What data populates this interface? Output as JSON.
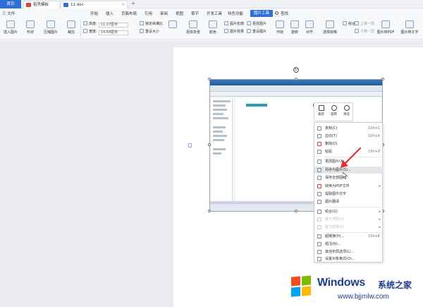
{
  "tabbar": {
    "home": "首页",
    "tabs": [
      {
        "label": "稻壳模板",
        "icon": "docer-icon",
        "color": "#d9433a"
      },
      {
        "label": "12.doc",
        "icon": "word-doc-icon",
        "color": "#2f6fd6"
      }
    ],
    "new_tab": "+"
  },
  "menubar": {
    "file": "三 文件",
    "items": [
      "开始",
      "插入",
      "页面布局",
      "引用",
      "审阅",
      "视图",
      "章节",
      "开发工具",
      "特色功能"
    ],
    "active": "图片工具",
    "search": "查找"
  },
  "ribbon": {
    "insert_picture": "插入图片",
    "shape": "形状",
    "compress": "压缩图片",
    "crop": "裁剪",
    "height_label": "高度:",
    "height_value": "11.27厘米",
    "width_label": "宽度:",
    "width_value": "14.64厘米",
    "lock_ratio": "锁定纵横比",
    "reset_size": "重设大小",
    "remove_bg": "抠除背景",
    "color": "颜色",
    "outline": "图片轮廓",
    "effects": "图片效果",
    "change_pic": "更改图片",
    "reset_pic": "重设图片",
    "wrap": "环绕",
    "rotate": "旋转",
    "align": "对齐",
    "select_pane": "选择窗格",
    "group": "组合",
    "bring_forward": "上移一层",
    "send_backward": "下移一层",
    "pic_to_pdf": "图片转PDF",
    "pic_to_text": "图片转文字"
  },
  "mini_toolbar": {
    "crop": "裁剪",
    "rotate": "旋转",
    "preview": "预览"
  },
  "context_menu": [
    {
      "label": "复制(C)",
      "shortcut": "Ctrl+C",
      "icon": "copy-icon"
    },
    {
      "label": "剪切(T)",
      "shortcut": "Ctrl+X",
      "icon": "cut-icon"
    },
    {
      "label": "删除(D)",
      "shortcut": "",
      "icon": "delete-icon"
    },
    {
      "label": "粘贴",
      "shortcut": "Ctrl+V",
      "icon": "paste-icon"
    },
    {
      "label": "更改图片(A)...",
      "shortcut": "",
      "icon": "change-picture-icon"
    },
    {
      "label": "另存为图片(S)...",
      "shortcut": "",
      "icon": "save-as-picture-icon",
      "state": "hover"
    },
    {
      "label": "保存全部图片",
      "shortcut": "",
      "icon": "save-all-pictures-icon"
    },
    {
      "label": "转换为PDF文件",
      "shortcut": "",
      "icon": "pdf-icon",
      "submenu": true
    },
    {
      "label": "提取图中文字",
      "shortcut": "",
      "icon": "extract-text-icon"
    },
    {
      "label": "图片翻译",
      "shortcut": "",
      "icon": "translate-icon"
    },
    {
      "label": "组合(G)",
      "shortcut": "",
      "icon": "group-icon",
      "submenu": true
    },
    {
      "label": "置于顶层(U)",
      "shortcut": "",
      "icon": "bring-to-front-icon",
      "state": "disabled",
      "submenu": true
    },
    {
      "label": "置于底层(K)",
      "shortcut": "",
      "icon": "send-to-back-icon",
      "state": "disabled",
      "submenu": true
    },
    {
      "label": "超链接(H)...",
      "shortcut": "Ctrl+K",
      "icon": "hyperlink-icon"
    },
    {
      "label": "题注(N)...",
      "shortcut": "",
      "icon": "caption-icon"
    },
    {
      "label": "其他布局选项(L)...",
      "shortcut": "",
      "icon": "layout-options-icon"
    },
    {
      "label": "设置对象格式(O)...",
      "shortcut": "",
      "icon": "format-object-icon"
    }
  ],
  "watermark": {
    "brand": "Windows",
    "brand_cn": "系统之家",
    "url": "www.bjjmlw.com"
  },
  "colors": {
    "accent": "#2f6fd6",
    "arrow": "#e03030"
  }
}
